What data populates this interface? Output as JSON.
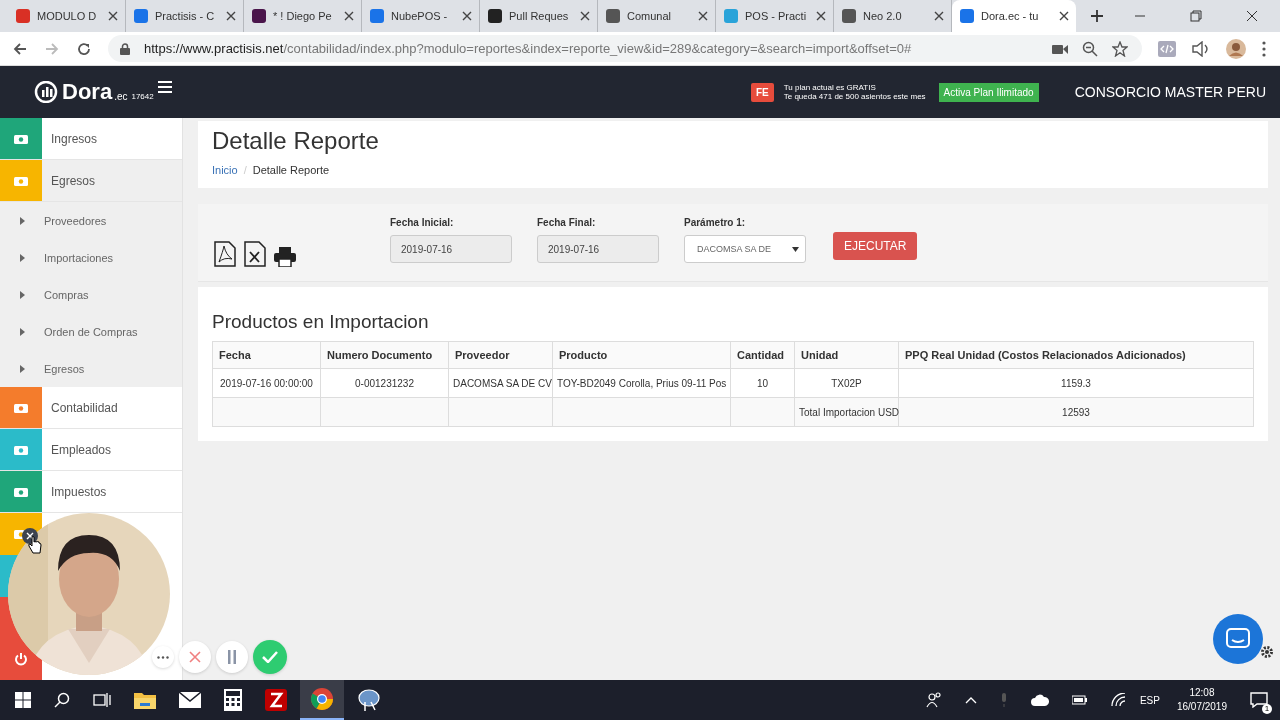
{
  "browser": {
    "tabs": [
      {
        "title": "MODULO D",
        "selected": false
      },
      {
        "title": "Practisis - C",
        "selected": false
      },
      {
        "title": "* ! Diego Pe",
        "selected": false
      },
      {
        "title": "NubePOS -",
        "selected": false
      },
      {
        "title": "Pull Reques",
        "selected": false
      },
      {
        "title": "Comunal",
        "selected": false
      },
      {
        "title": "POS - Practi",
        "selected": false
      },
      {
        "title": "Neo 2.0",
        "selected": false
      },
      {
        "title": "Dora.ec - tu",
        "selected": true
      }
    ],
    "url_host": "https://www.practisis.net",
    "url_path": "/contabilidad/index.php?modulo=reportes&index=reporte_view&id=289&category=&search=import&offset=0#"
  },
  "header": {
    "logo": "Dora",
    "logo_suffix": ".ec",
    "account_number": "17642",
    "fe_badge": "FE",
    "plan_line_1": "Tu plan actual es GRATIS",
    "plan_line_2": "Te queda 471 de 500 asientos este mes",
    "plan_button": "Activa Plan Ilimitado",
    "company": "CONSORCIO MASTER PERU"
  },
  "sidebar": {
    "items": [
      {
        "kind": "module",
        "label": "Ingresos",
        "color": "#1fa67a",
        "expanded": false
      },
      {
        "kind": "module",
        "label": "Egresos",
        "color": "#f7b500",
        "expanded": true,
        "children": [
          {
            "label": "Proveedores"
          },
          {
            "label": "Importaciones"
          },
          {
            "label": "Compras"
          },
          {
            "label": "Orden de Compras"
          },
          {
            "label": "Egresos"
          }
        ]
      },
      {
        "kind": "module",
        "label": "Contabilidad",
        "color": "#f47c2c",
        "expanded": false
      },
      {
        "kind": "module",
        "label": "Empleados",
        "color": "#2bbbc9",
        "expanded": false
      },
      {
        "kind": "module",
        "label": "Impuestos",
        "color": "#1fa67a",
        "expanded": false
      },
      {
        "kind": "module",
        "color": "#f7b500",
        "expanded": false
      },
      {
        "kind": "blank",
        "color": "#2bbbc9",
        "expanded": false
      },
      {
        "kind": "logout",
        "color": "#e74c3c",
        "expanded": false
      }
    ]
  },
  "page": {
    "title": "Detalle Reporte",
    "breadcrumb": [
      "Inicio",
      "Detalle Reporte"
    ],
    "breadcrumb_separator": "/"
  },
  "filters": {
    "fields": [
      {
        "kind": "date",
        "label": "Fecha Inicial:",
        "value": "2019-07-16"
      },
      {
        "kind": "date",
        "label": "Fecha Final:",
        "value": "2019-07-16"
      },
      {
        "kind": "select",
        "label": "Parámetro 1:",
        "value": "DACOMSA SA DE"
      }
    ],
    "run_button": "EJECUTAR"
  },
  "report": {
    "title": "Productos en Importacion",
    "columns": [
      "Fecha",
      "Numero Documento",
      "Proveedor",
      "Producto",
      "Cantidad",
      "Unidad",
      "PPQ Real Unidad (Costos Relacionados Adicionados)"
    ],
    "rows": [
      [
        "2019-07-16 00:00:00",
        "0-001231232",
        "DACOMSA SA DE CV",
        "TOY-BD2049 Corolla, Prius 09-11 Pos",
        "10",
        "TX02P",
        "1159.3"
      ]
    ],
    "total_label": "Total Importacion USD",
    "total_value": "12593"
  },
  "taskbar": {
    "language": "ESP",
    "time": "12:08",
    "date": "16/07/2019",
    "notifications": "1"
  }
}
